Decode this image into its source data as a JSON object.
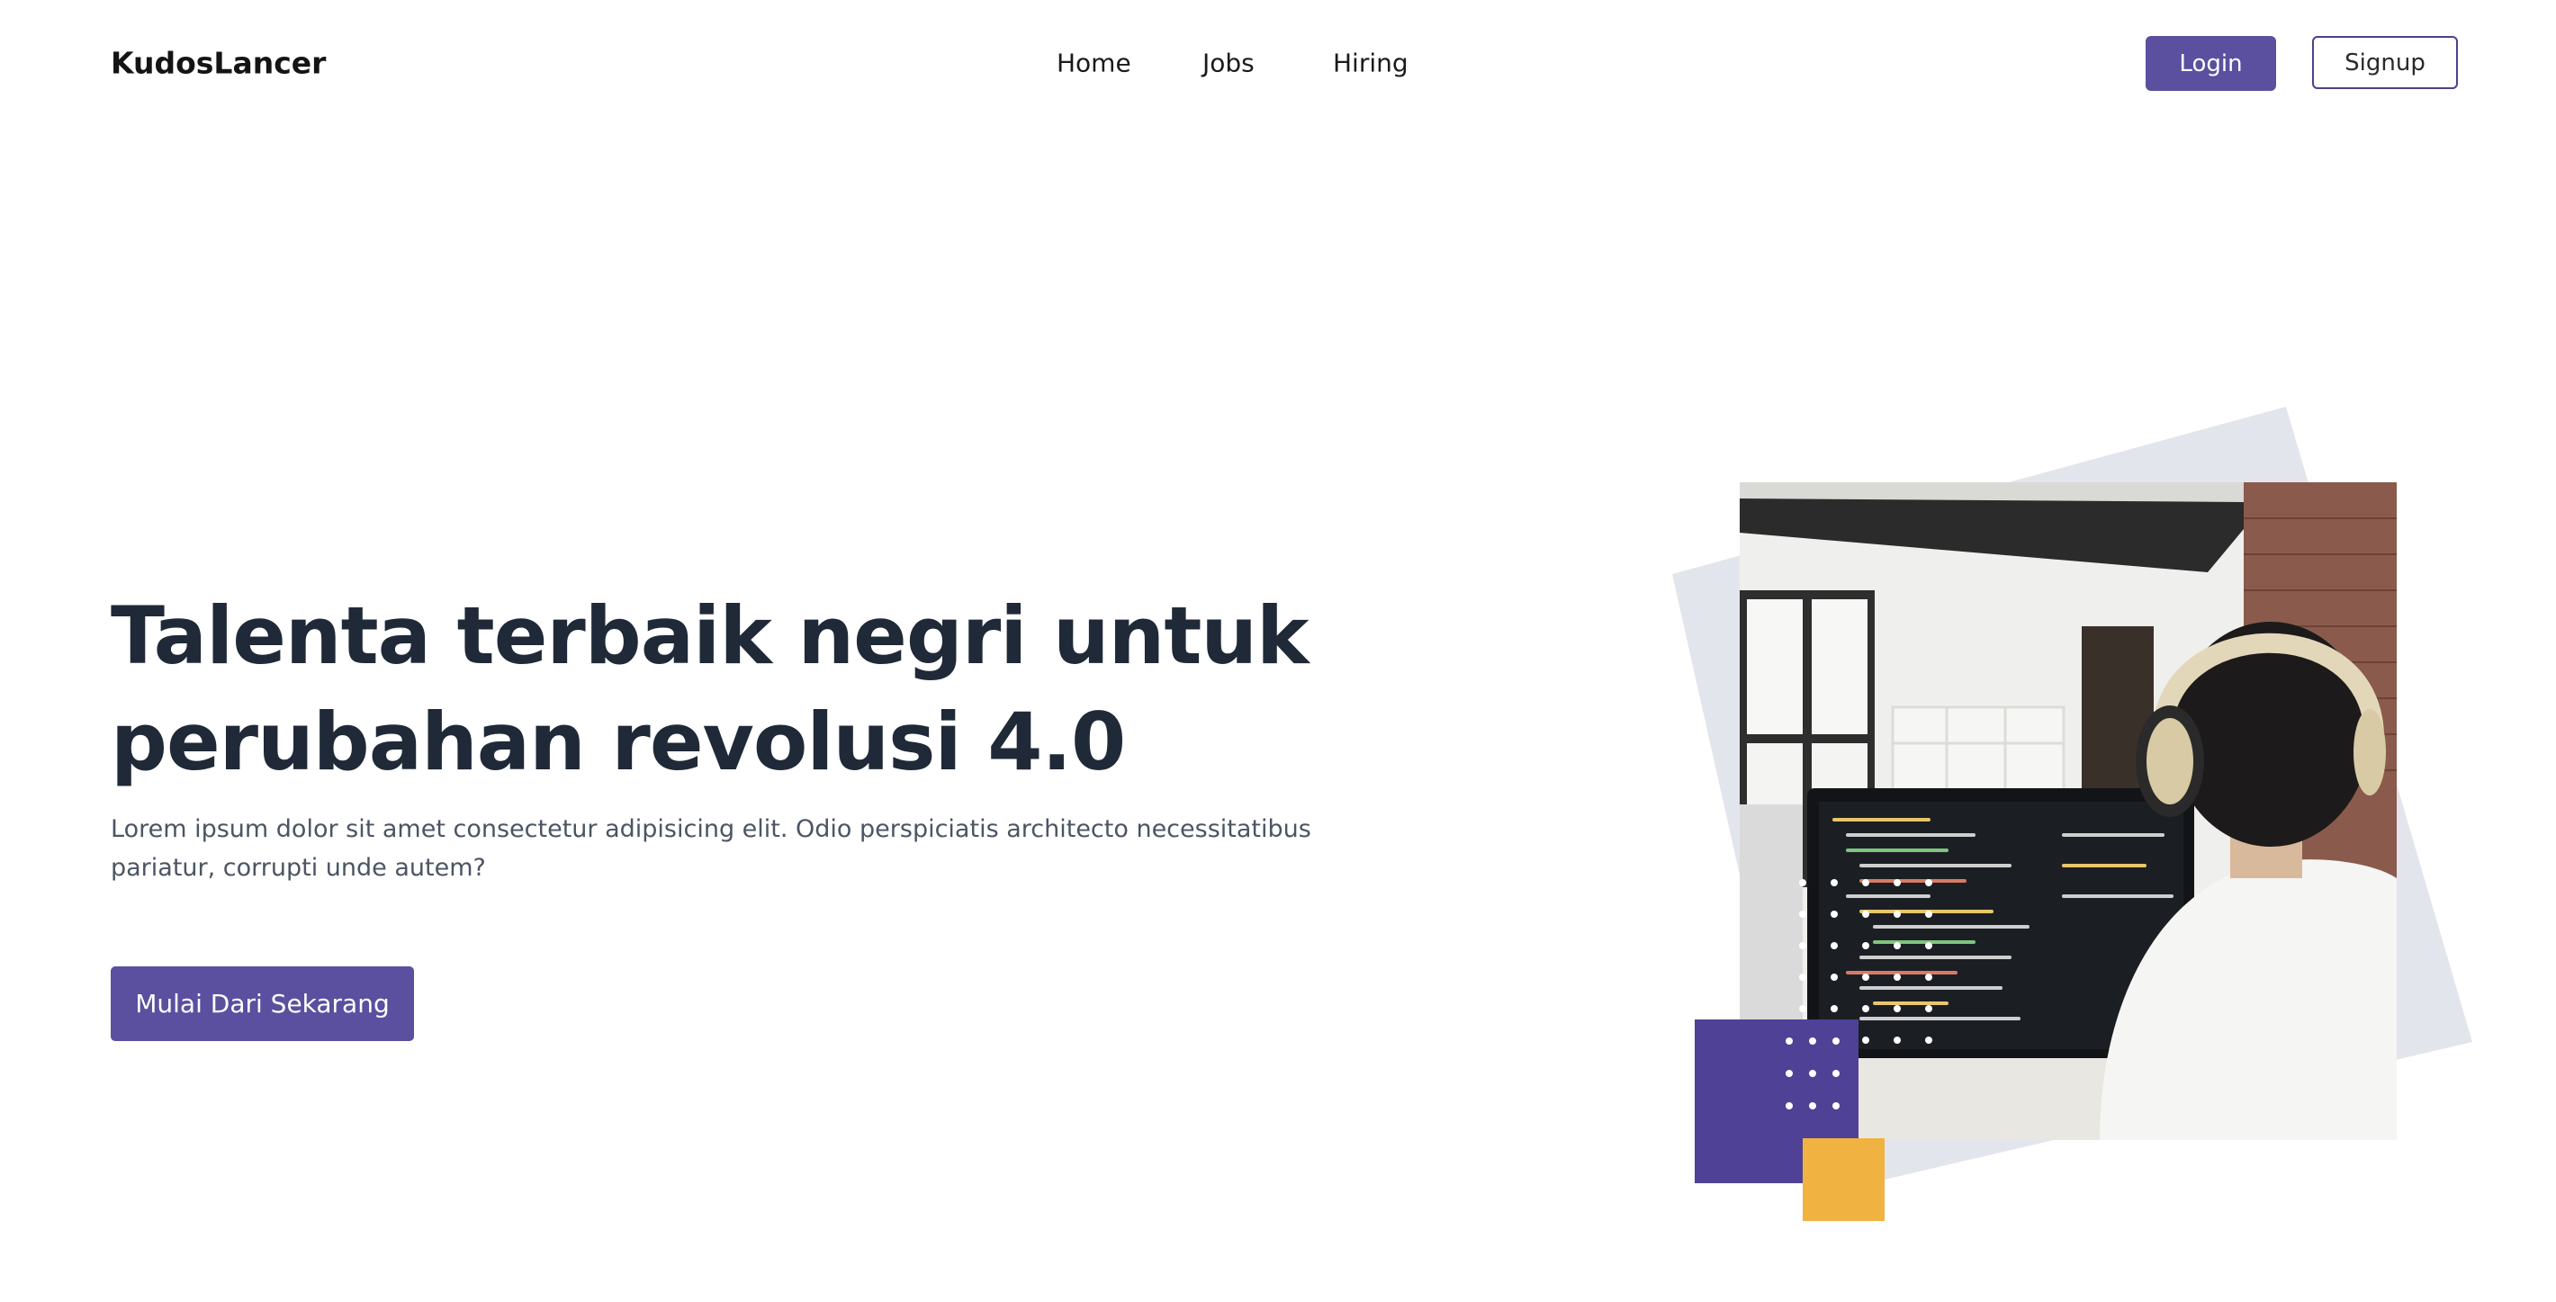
{
  "brand": "KudosLancer",
  "nav": {
    "items": [
      {
        "label": "Home"
      },
      {
        "label": "Jobs"
      },
      {
        "label": "Hiring"
      }
    ]
  },
  "auth": {
    "login_label": "Login",
    "signup_label": "Signup"
  },
  "hero": {
    "title_lines": [
      "Talenta terbaik negri untuk",
      "perubahan revolusi 4.0"
    ],
    "description_lines": [
      "Lorem ipsum dolor sit amet consectetur adipisicing elit. Odio perspiciatis architecto necessitatibus",
      "pariatur, corrupti unde autem?"
    ],
    "cta_label": "Mulai Dari Sekarang"
  },
  "colors": {
    "primary": "#5b4f9f",
    "accent_purple": "#4f4196",
    "accent_yellow": "#f0b342",
    "bg_shape": "#e3e5ec",
    "heading": "#1f2937",
    "body_text": "#4b5563"
  }
}
